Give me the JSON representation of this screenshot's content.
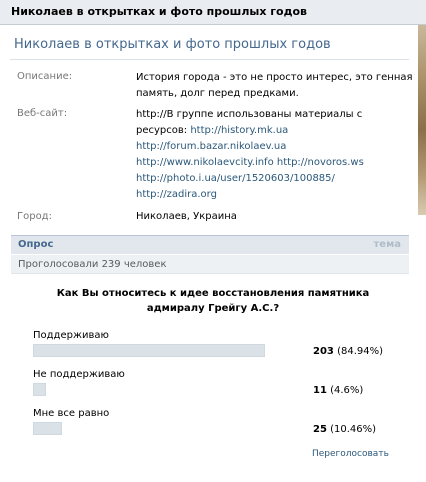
{
  "window": {
    "title": "Николаев в открытках и фото прошлых годов"
  },
  "group": {
    "title": "Николаев в открытках и фото прошлых годов",
    "info": {
      "description_label": "Описание:",
      "description_lines": [
        "История города - это не просто интерес, это генная",
        "память, долг перед предками."
      ],
      "website_label": "Веб-сайт:",
      "website_intro": "http://В группе использованы материалы с",
      "website_intro2": "ресурсов: ",
      "links": [
        "http://history.mk.ua",
        "http://forum.bazar.nikolaev.ua",
        "http://www.nikolaevcity.info",
        "http://novoros.ws",
        "http://photo.i.ua/user/1520603/100885/",
        "http://zadira.org"
      ],
      "city_label": "Город:",
      "city_value": "Николаев, Украина"
    }
  },
  "poll": {
    "header": "Опрос",
    "topic_link": "тема",
    "votes_text": "Проголосовали 239 человек",
    "question_lines": [
      "Как Вы относитесь к идее восстановления памятника",
      "адмиралу Грейгу А.С.?"
    ],
    "options": [
      {
        "label": "Поддерживаю",
        "count": "203",
        "percent": "(84.94%)",
        "share": 0.8494
      },
      {
        "label": "Не поддерживаю",
        "count": "11",
        "percent": "(4.6%)",
        "share": 0.046
      },
      {
        "label": "Мне все равно",
        "count": "25",
        "percent": "(10.46%)",
        "share": 0.1046
      }
    ],
    "revote_label": "Переголосовать"
  }
}
